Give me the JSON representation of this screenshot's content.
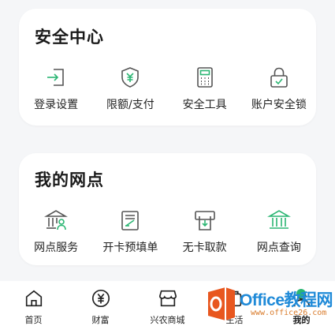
{
  "security": {
    "title": "安全中心",
    "items": [
      {
        "label": "登录设置",
        "icon": "login-arrow-icon"
      },
      {
        "label": "限额/支付",
        "icon": "shield-yuan-icon"
      },
      {
        "label": "安全工具",
        "icon": "calculator-icon"
      },
      {
        "label": "账户安全锁",
        "icon": "lock-icon"
      }
    ]
  },
  "branch": {
    "title": "我的网点",
    "items": [
      {
        "label": "网点服务",
        "icon": "bank-person-icon"
      },
      {
        "label": "开卡预填单",
        "icon": "form-edit-icon"
      },
      {
        "label": "无卡取款",
        "icon": "atm-withdraw-icon"
      },
      {
        "label": "网点查询",
        "icon": "bank-building-icon"
      }
    ]
  },
  "nav": {
    "tabs": [
      {
        "label": "首页",
        "icon": "home-icon"
      },
      {
        "label": "财富",
        "icon": "yuan-circle-icon"
      },
      {
        "label": "兴农商城",
        "icon": "shop-icon"
      },
      {
        "label": "生活",
        "icon": "life-icon"
      },
      {
        "label": "我的",
        "icon": "profile-icon"
      }
    ]
  },
  "watermark": {
    "text": "Office教程网",
    "sub": "www.office26.com"
  },
  "colors": {
    "accent": "#2bb673",
    "icon_stroke": "#555555",
    "watermark": "#1f8ad8"
  }
}
